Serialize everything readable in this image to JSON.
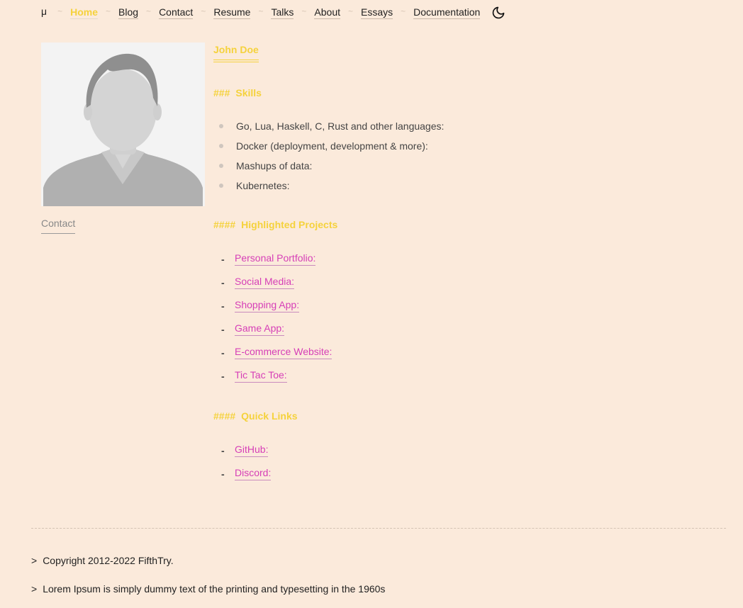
{
  "nav": {
    "logo": "μ",
    "separator": "~",
    "items": [
      {
        "label": "Home",
        "active": true
      },
      {
        "label": "Blog"
      },
      {
        "label": "Contact"
      },
      {
        "label": "Resume"
      },
      {
        "label": "Talks"
      },
      {
        "label": "About"
      },
      {
        "label": "Essays"
      },
      {
        "label": "Documentation"
      }
    ],
    "theme_icon": "moon-icon"
  },
  "sidebar": {
    "avatar_icon": "person-silhouette",
    "contact_label": "Contact"
  },
  "profile": {
    "name": "John Doe"
  },
  "skills": {
    "hash": "###",
    "title": "Skills",
    "items": [
      "Go, Lua, Haskell, C, Rust and other languages:",
      "Docker (deployment, development & more):",
      "Mashups of data:",
      "Kubernetes:"
    ]
  },
  "projects": {
    "hash": "####",
    "title": "Highlighted Projects",
    "items": [
      "Personal Portfolio:",
      "Social Media:",
      "Shopping App:",
      "Game App:",
      "E-commerce Website:",
      "Tic Tac Toe:"
    ]
  },
  "quick_links": {
    "hash": "####",
    "title": "Quick Links",
    "items": [
      "GitHub:",
      "Discord:"
    ]
  },
  "footer": {
    "marker": ">",
    "lines": [
      "Copyright 2012-2022 FifthTry.",
      "Lorem Ipsum is simply dummy text of the printing and typesetting in the 1960s"
    ]
  },
  "colors": {
    "background": "#fbeadb",
    "accent": "#f5d23c",
    "link": "#d63fb7"
  }
}
